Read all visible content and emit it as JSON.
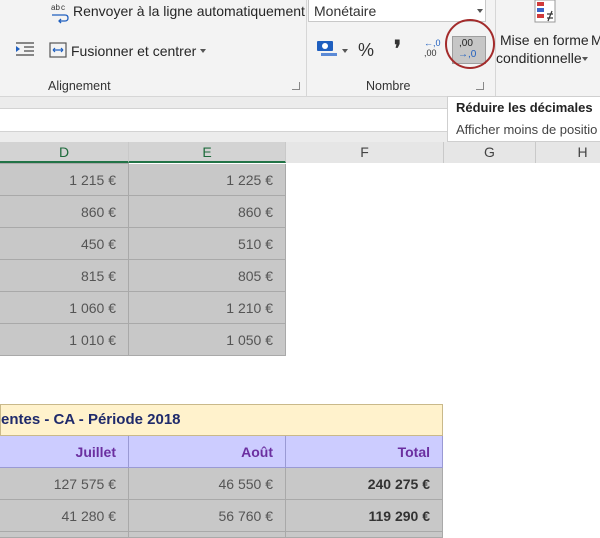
{
  "ribbon": {
    "wrap_text_label": "Renvoyer à la ligne automatiquement",
    "merge_center_label": "Fusionner et centrer",
    "alignment_group": "Alignement",
    "number_format_value": "Monétaire",
    "percent_symbol": "%",
    "comma_symbol": "❜",
    "increase_decimal_top": "←,0",
    "increase_decimal_bottom": ",00",
    "decrease_decimal_top": ",00",
    "decrease_decimal_bottom": "→,0",
    "number_group": "Nombre",
    "conditional_format_line1": "Mise en forme",
    "conditional_format_line2": "conditionnelle",
    "next_label": "M"
  },
  "tooltip": {
    "title": "Réduire les décimales",
    "description": "Afficher moins de positio"
  },
  "columns": [
    "D",
    "E",
    "F",
    "G",
    "H"
  ],
  "upper_table": {
    "rows": [
      [
        "1 215 €",
        "1 225 €"
      ],
      [
        "860 €",
        "860 €"
      ],
      [
        "450 €",
        "510 €"
      ],
      [
        "815 €",
        "805 €"
      ],
      [
        "1 060 €",
        "1 210 €"
      ],
      [
        "1 010 €",
        "1 050 €"
      ]
    ]
  },
  "lower_table": {
    "title": "entes - CA - Période 2018",
    "headers": [
      "Juillet",
      "Août",
      "Total"
    ],
    "rows": [
      [
        "127 575 €",
        "46 550 €",
        "240 275 €"
      ],
      [
        "41 280 €",
        "56 760 €",
        "119 290 €"
      ]
    ]
  },
  "colors": {
    "selection_green": "#217346",
    "header_fill": "#ccccff",
    "title_fill": "#fff2cc",
    "circle": "#a32b2b"
  }
}
